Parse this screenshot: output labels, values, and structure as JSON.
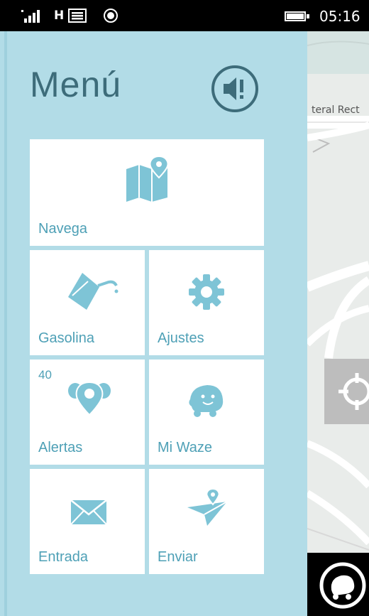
{
  "status_bar": {
    "network": "H",
    "time": "05:16"
  },
  "menu": {
    "title": "Menú",
    "tiles": {
      "navigate": {
        "label": "Navega"
      },
      "gas": {
        "label": "Gasolina"
      },
      "settings": {
        "label": "Ajustes"
      },
      "alerts": {
        "label": "Alertas",
        "count": "40"
      },
      "my_waze": {
        "label": "Mi Waze"
      },
      "inbox": {
        "label": "Entrada"
      },
      "send": {
        "label": "Enviar"
      }
    }
  },
  "map": {
    "street_label": "teral Rect"
  },
  "colors": {
    "panel": "#b2dce7",
    "tile": "#ffffff",
    "icon": "#7ec4d6",
    "label": "#4ea0b6",
    "title": "#3d6c7a"
  }
}
